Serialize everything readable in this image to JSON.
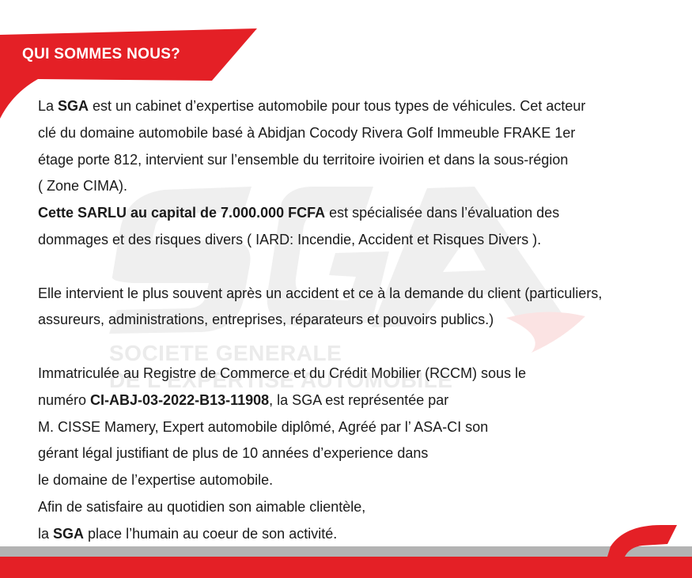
{
  "header": {
    "title": "QUI SOMMES NOUS?"
  },
  "watermark": {
    "logo_text": "SGA",
    "line1": "SOCIETE GENERALE",
    "line2": "DE L'EXPERTISE AUTOMOBILE"
  },
  "paragraph1": {
    "l1_a": "La ",
    "l1_b": "SGA",
    "l1_c": " est un cabinet d’expertise automobile pour tous types de  véhicules. Cet acteur",
    "l2": "clé du domaine automobile basé à Abidjan Cocody Rivera Golf Immeuble FRAKE 1er",
    "l3": "étage porte 812, intervient sur l’ensemble du territoire ivoirien et dans la sous-région",
    "l4": "( Zone CIMA).",
    "l5_a": "Cette SARLU au capital de 7.000.000 FCFA",
    "l5_b": " est spécialisée dans l’évaluation des",
    "l6": "dommages et des risques divers ( IARD: Incendie, Accident et Risques Divers )."
  },
  "paragraph2": {
    "l1": "Elle intervient le plus souvent après un accident et ce à la demande du client (particuliers,",
    "l2": "assureurs, administrations, entreprises, réparateurs et pouvoirs publics.)"
  },
  "paragraph3": {
    "l1": "Immatriculée au Registre de Commerce et du Crédit Mobilier (RCCM) sous le",
    "l2_a": "numéro ",
    "l2_b": "CI-ABJ-03-2022-B13-11908",
    "l2_c": ", la SGA est  représentée par",
    "l3": "M. CISSE Mamery, Expert automobile diplômé, Agréé par l’ ASA-CI son",
    "l4": "gérant légal justifiant de plus de 10 années d’experience dans",
    "l5": "le domaine de l’expertise automobile.",
    "l6": "Afin de satisfaire au quotidien son aimable clientèle,",
    "l7_a": "la ",
    "l7_b": "SGA",
    "l7_c": " place l’humain au coeur de son activité."
  },
  "colors": {
    "accent_red": "#e42026",
    "footer_gray": "#b3b3b3",
    "watermark_gray": "#ebebeb"
  }
}
